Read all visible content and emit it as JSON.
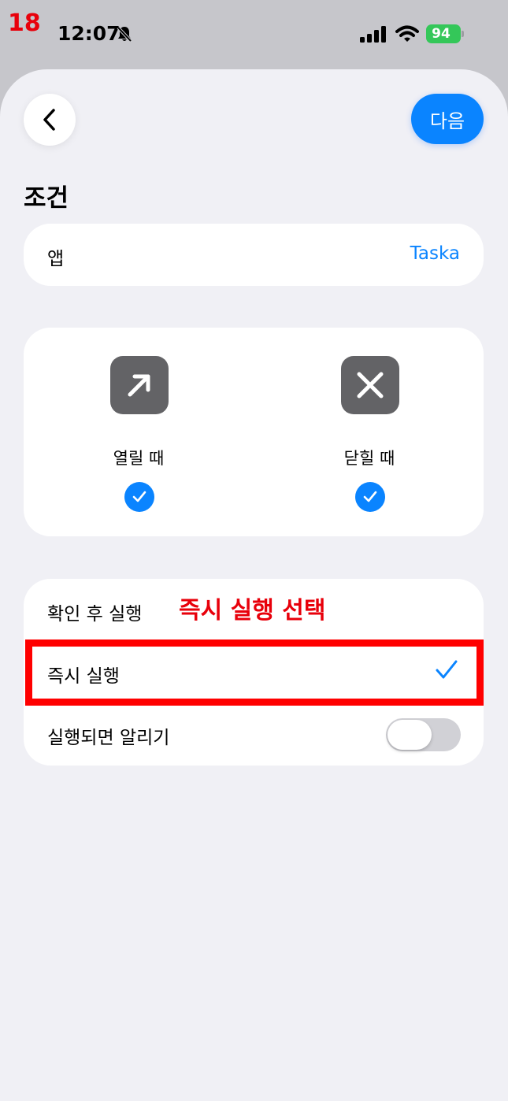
{
  "status": {
    "step": "18",
    "time": "12:07",
    "battery": "94"
  },
  "header": {
    "next_label": "다음"
  },
  "section": {
    "title": "조건"
  },
  "app_row": {
    "label": "앱",
    "value": "Taska"
  },
  "triggers": {
    "open_label": "열릴 때",
    "close_label": "닫힐 때"
  },
  "options": {
    "confirm_label": "확인 후 실행",
    "immediate_label": "즉시 실행",
    "notify_label": "실행되면 알리기",
    "annotation": "즉시 실행 선택"
  },
  "colors": {
    "accent": "#0a84ff",
    "annotation": "#e8000b",
    "battery": "#34c759"
  }
}
